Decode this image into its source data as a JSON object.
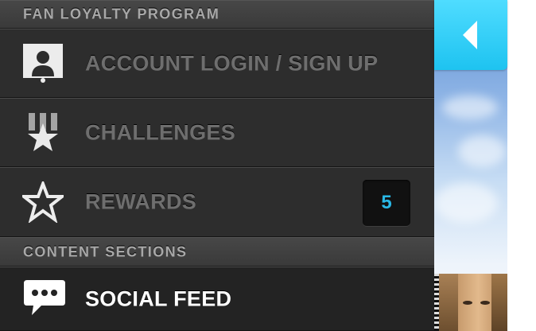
{
  "menu": {
    "loyalty_header": "FAN LOYALTY PROGRAM",
    "content_header": "CONTENT SECTIONS",
    "items": [
      {
        "label": "ACCOUNT LOGIN / SIGN UP",
        "icon": "account-card-icon"
      },
      {
        "label": "CHALLENGES",
        "icon": "ribbon-star-icon"
      },
      {
        "label": "REWARDS",
        "icon": "star-outline-icon",
        "badge": "5"
      },
      {
        "label": "SOCIAL FEED",
        "icon": "speech-bubble-icon",
        "active": true
      }
    ]
  },
  "colors": {
    "accent": "#29b8e6",
    "back_tab": "#2cc9f3",
    "panel": "#2b2b2b"
  }
}
